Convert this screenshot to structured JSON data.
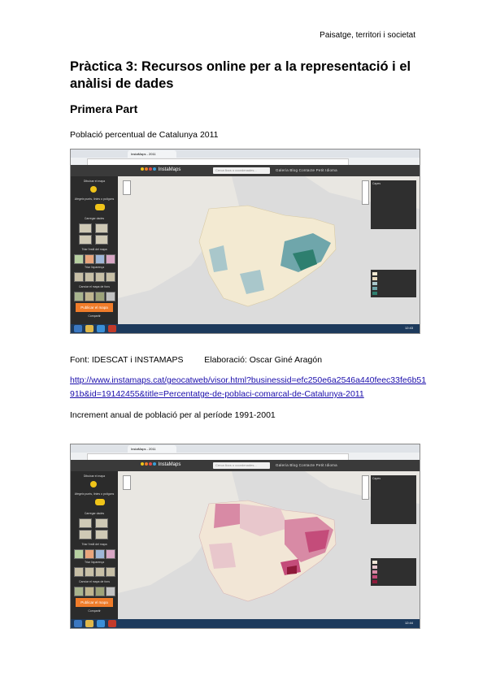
{
  "header": {
    "right_text": "Paisatge, territori i societat"
  },
  "title": "Pràctica 3: Recursos online per a la representació i el anàlisi de dades",
  "subtitle": "Primera Part",
  "section1": {
    "caption": "Població percentual de Catalunya 2011"
  },
  "source_line": {
    "font": "Font: IDESCAT i INSTAMAPS",
    "author": "Elaboració: Oscar Giné Aragón"
  },
  "link": {
    "text": "http://www.instamaps.cat/geocatweb/visor.html?businessid=efc250e6a2546a440feec33fe6b5191b&id=19142455&title=Percentatge-de-poblaci-comarcal-de-Catalunya-2011"
  },
  "section2": {
    "caption": "Increment anual de població per al període 1991-2001"
  },
  "app": {
    "brand": "InstaMaps",
    "tab_label": "InstaMaps - 2011",
    "search_placeholder": "Cerca llocs o coordenades...",
    "nav": "Galeria   Blog   Contacte   Petit   Idioma",
    "sidebar_sections": [
      "Dibuixar el mapa",
      "Afegeix punts, línies o polígons",
      "Carregar dades",
      "Triar l'estil del mapa",
      "Triar l'aparença",
      "Canviar el mapa de fons",
      "Compartir"
    ],
    "publish_button": "Publicar el mapa",
    "clock1": "12:43",
    "clock2": "12:44",
    "legend_title": "Capes"
  },
  "colors": {
    "map1": [
      "#f3ead2",
      "#e9dcc0",
      "#a9c7cb",
      "#6fa6ab",
      "#2e7f6f"
    ],
    "map2": [
      "#f2e6d6",
      "#e8c7cc",
      "#d88aa5",
      "#c44c7a",
      "#8f1a3a"
    ],
    "link": "#1a0dab",
    "publish": "#f07c2a"
  }
}
